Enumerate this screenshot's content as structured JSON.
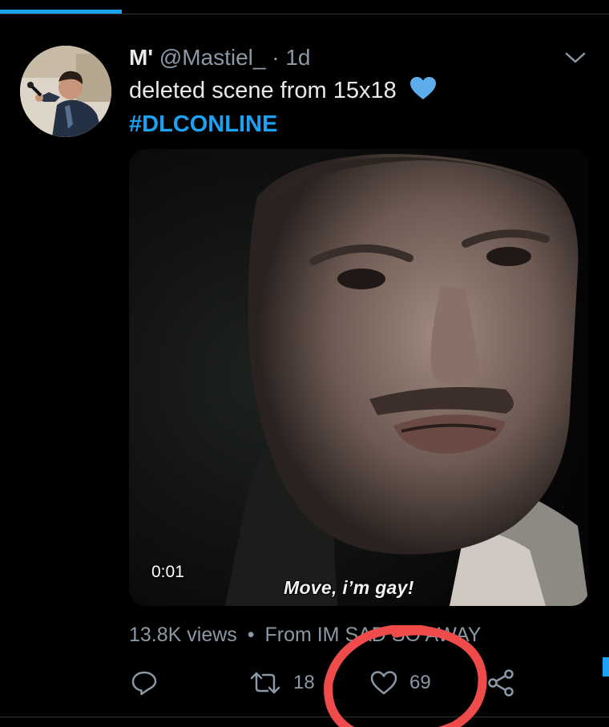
{
  "tweet": {
    "display_name": "M'",
    "handle": "@Mastiel_",
    "separator": "·",
    "time_ago": "1d",
    "text": "deleted scene from 15x18",
    "hashtag": "#DLCONLINE"
  },
  "media": {
    "video_time": "0:01",
    "subtitle": "Move, i’m gay!"
  },
  "meta": {
    "views": "13.8K views",
    "bullet": "•",
    "source": "From IM SAD SO AWAY"
  },
  "actions": {
    "retweet_count": "18",
    "like_count": "69"
  },
  "colors": {
    "accent": "#1da1f2",
    "annotation": "#ef4b4b",
    "background": "#000000",
    "secondary_text": "#8b98a5"
  },
  "icons": [
    "chevron-down-icon",
    "blue-heart-emoji",
    "reply-icon",
    "retweet-icon",
    "like-heart-icon",
    "share-icon"
  ]
}
